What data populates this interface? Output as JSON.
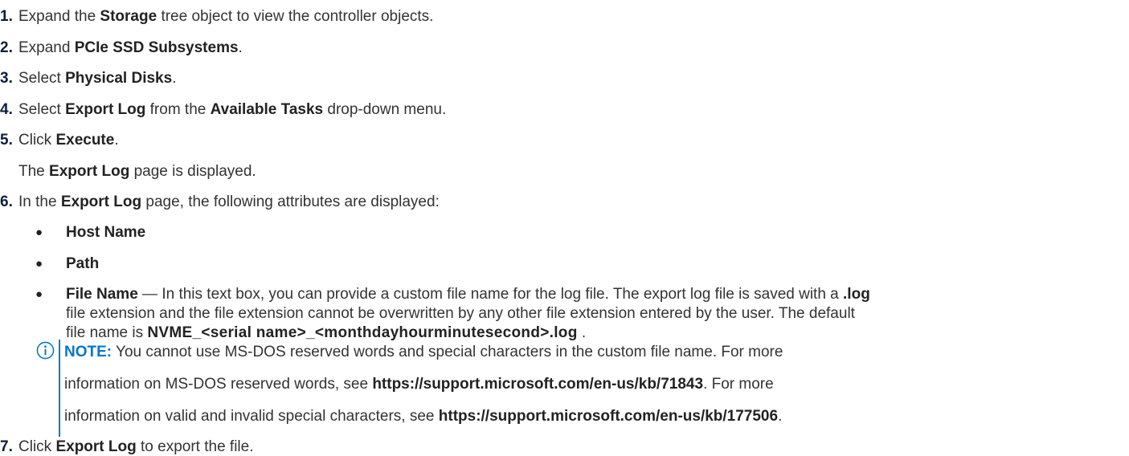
{
  "steps": [
    {
      "num": "1.",
      "t1": "Expand the ",
      "b1": "Storage",
      "t2": " tree object to view the controller objects."
    },
    {
      "num": "2.",
      "t1": "Expand ",
      "b1": "PCIe SSD Subsystems",
      "t2": "."
    },
    {
      "num": "3.",
      "t1": "Select ",
      "b1": "Physical Disks",
      "t2": "."
    },
    {
      "num": "4.",
      "t1": "Select ",
      "b1": "Export Log",
      "t2": " from the ",
      "b2": "Available Tasks",
      "t3": " drop-down menu."
    },
    {
      "num": "5.",
      "t1": "Click ",
      "b1": "Execute",
      "t2": "."
    },
    {
      "t1": "The ",
      "b1": "Export Log",
      "t2": " page is displayed."
    },
    {
      "num": "6.",
      "t1": "In the ",
      "b1": "Export Log",
      "t2": " page, the following attributes are displayed:"
    },
    {
      "num": "7.",
      "t1": "Click ",
      "b1": "Export Log",
      "t2": " to export the file."
    }
  ],
  "bullets": {
    "host_name": "Host Name",
    "path": "Path",
    "file_name": "File Name",
    "file_name_l1": " — In this text box, you can provide a custom file name for the log file. The export log file is saved with a ",
    "file_ext": ".log",
    "file_name_l2": "file extension and the file extension cannot be overwritten by any other file extension entered by the user. The default",
    "file_name_l3a": "file name is ",
    "default_name": "NVME_<serial name>_<monthdayhourminutesecond>.log",
    "file_name_l3b": " ."
  },
  "note": {
    "label": "NOTE:",
    "l1": " You cannot use MS-DOS reserved words and special characters in the custom file name. For more",
    "l2a": "information on MS-DOS reserved words, see ",
    "link1": "https://support.microsoft.com/en-us/kb/71843",
    "l2b": ". For more",
    "l3a": "information on valid and invalid special characters, see ",
    "link2": "https://support.microsoft.com/en-us/kb/177506",
    "l3b": ".",
    "icon": "info-icon",
    "accent": "#0076ce"
  }
}
